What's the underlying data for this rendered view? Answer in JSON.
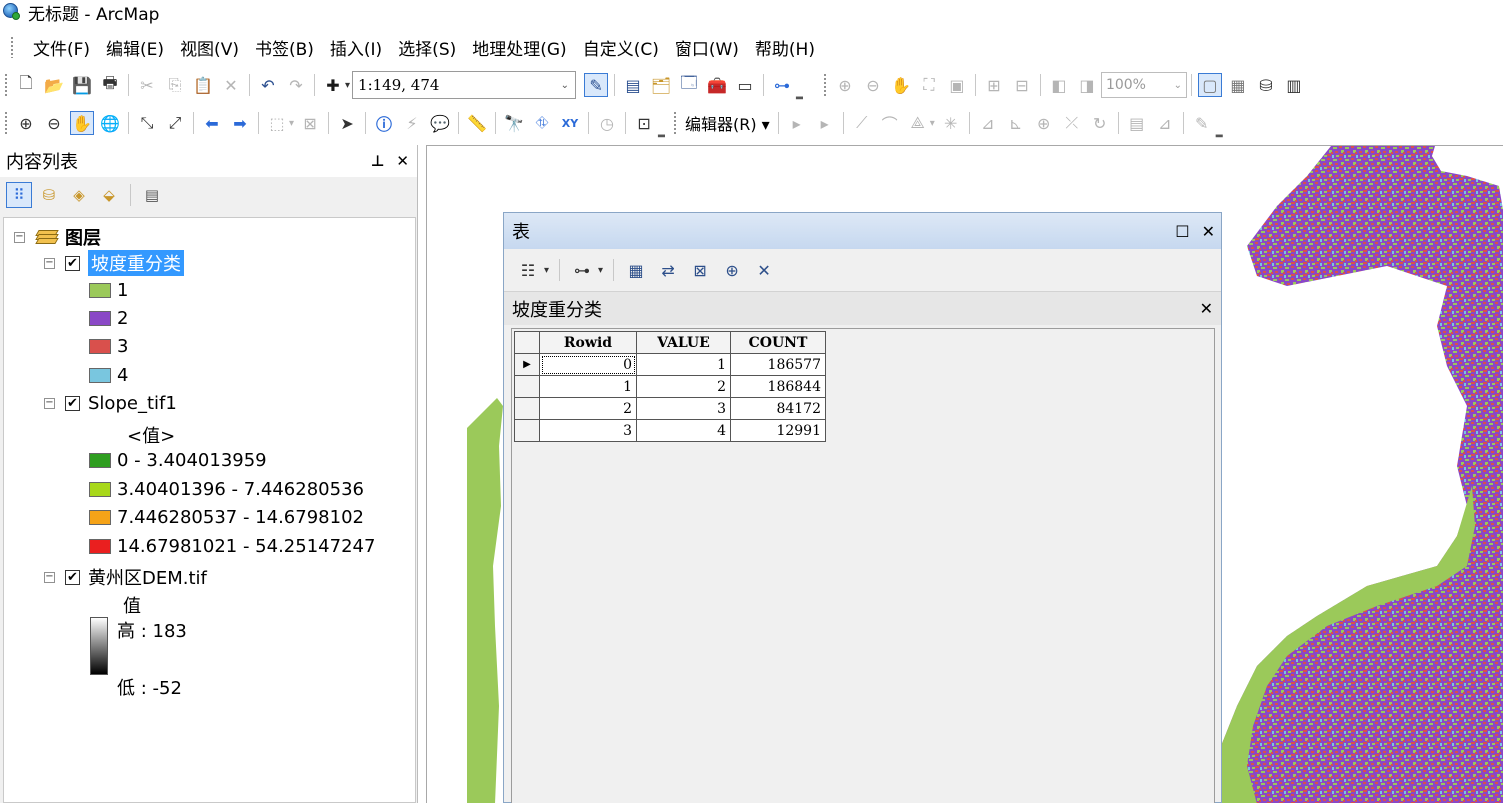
{
  "window": {
    "title": "无标题 - ArcMap"
  },
  "menubar": {
    "items": [
      "文件(F)",
      "编辑(E)",
      "视图(V)",
      "书签(B)",
      "插入(I)",
      "选择(S)",
      "地理处理(G)",
      "自定义(C)",
      "窗口(W)",
      "帮助(H)"
    ]
  },
  "toolbar": {
    "scale_value": "1:149, 474",
    "zoom_value": "100%",
    "editor_label": "编辑器(R)"
  },
  "toc": {
    "title": "内容列表",
    "pin_icon": "pin-icon",
    "close_icon": "close-icon",
    "root_label": "图层",
    "layers": [
      {
        "name": "坡度重分类",
        "checked": true,
        "selected": true,
        "classes": [
          {
            "label": "1",
            "color": "#9bc95a"
          },
          {
            "label": "2",
            "color": "#8a48c6"
          },
          {
            "label": "3",
            "color": "#d9504c"
          },
          {
            "label": "4",
            "color": "#79c6df"
          }
        ]
      },
      {
        "name": "Slope_tif1",
        "checked": true,
        "field_label": "<值>",
        "classes": [
          {
            "label": "0 - 3.404013959",
            "color": "#2f9e20"
          },
          {
            "label": "3.40401396 - 7.446280536",
            "color": "#a8d81a"
          },
          {
            "label": "7.446280537 - 14.6798102",
            "color": "#f5a318"
          },
          {
            "label": "14.67981021 - 54.25147247",
            "color": "#ea1f1f"
          }
        ]
      },
      {
        "name": "黄州区DEM.tif",
        "checked": true,
        "field_label": "值",
        "high_label": "高 : 183",
        "low_label": "低 : -52"
      }
    ]
  },
  "table_window": {
    "title": "表",
    "tab_name": "坡度重分类",
    "columns": [
      "Rowid",
      "VALUE",
      "COUNT"
    ],
    "rows": [
      [
        "0",
        "1",
        "186577"
      ],
      [
        "1",
        "2",
        "186844"
      ],
      [
        "2",
        "3",
        "84172"
      ],
      [
        "3",
        "4",
        "12991"
      ]
    ],
    "current_row": 0
  },
  "map": {
    "class_colors": [
      "#9bc95a",
      "#8a48c6",
      "#d9504c",
      "#79c6df"
    ]
  }
}
